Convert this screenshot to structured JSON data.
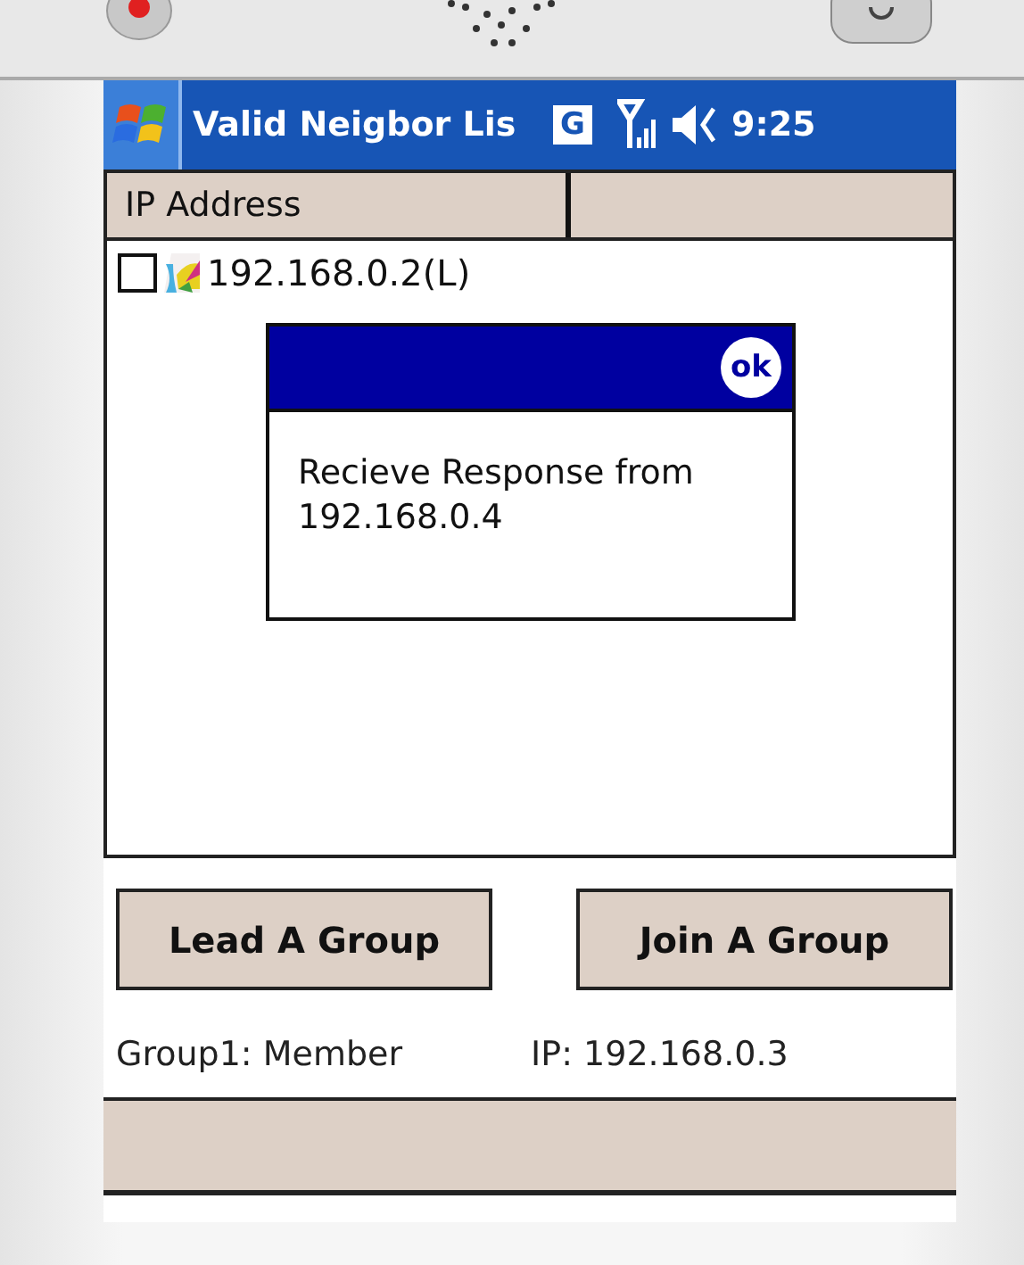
{
  "title_bar": {
    "title": "Valid Neigbor Lis",
    "network_badge": "G",
    "time": "9:25"
  },
  "list": {
    "columns": [
      "IP Address"
    ],
    "rows": [
      {
        "label": "192.168.0.2(L)",
        "checked": false
      }
    ]
  },
  "dialog": {
    "lines": [
      "Recieve Response from",
      "192.168.0.4"
    ],
    "ok": "ok"
  },
  "buttons": [
    "Lead A Group",
    "Join A Group"
  ],
  "status": {
    "group": "Group1: Member",
    "ip": "IP: 192.168.0.3"
  }
}
